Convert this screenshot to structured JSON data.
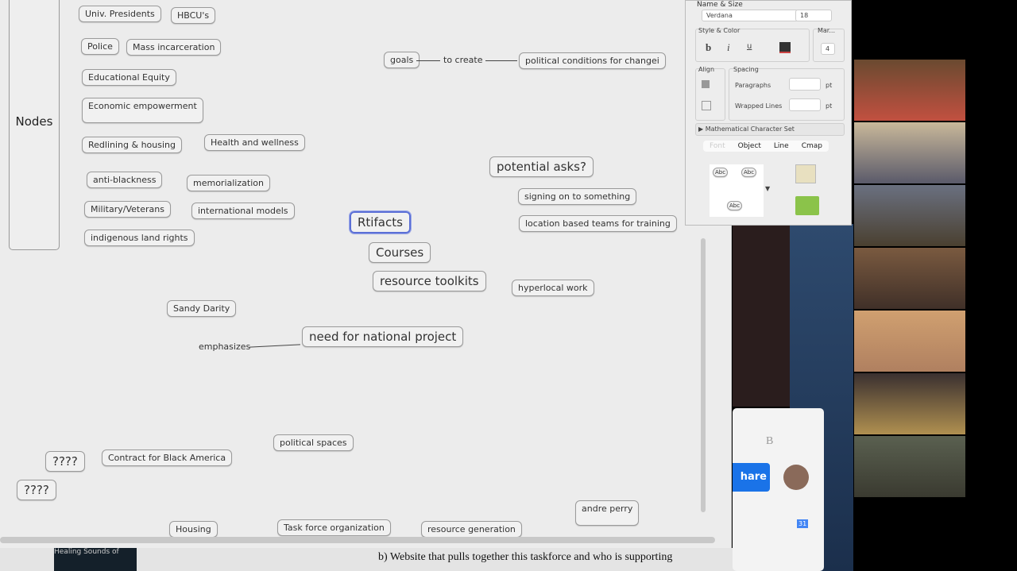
{
  "sidebar": {
    "title": "Nodes"
  },
  "nodes": [
    "Univ. Presidents",
    "HBCU's",
    "Police",
    "Mass incarceration",
    "Educational Equity",
    "Economic empowerment",
    "Redlining & housing",
    "Health and wellness",
    "anti-blackness",
    "memorialization",
    "Military/Veterans",
    "international models",
    "indigenous land rights",
    "goals",
    "political conditions for changei",
    "potential asks?",
    "signing on to something",
    "location based teams for training",
    "Rtifacts",
    "Courses",
    "resource toolkits",
    "hyperlocal work",
    "Sandy Darity",
    "need for national project",
    "political spaces",
    "????",
    "Contract for Black America",
    "????",
    "Housing",
    "Task force organization",
    "resource generation",
    "andre perry"
  ],
  "links": {
    "to_create": "to create",
    "emphasizes": "emphasizes"
  },
  "format_panel": {
    "name_size": "Name & Size",
    "font": "Verdana",
    "size": "18",
    "style_color": "Style & Color",
    "bold": "b",
    "italic": "i",
    "underline": "u",
    "margin_label": "Mar...",
    "margin": "4",
    "align": "Align",
    "spacing": "Spacing",
    "paragraphs": "Paragraphs",
    "wrapped_lines": "Wrapped Lines",
    "pt": "pt",
    "math_set": "Mathematical Character Set",
    "tabs": [
      "Font",
      "Object",
      "Line",
      "Cmap"
    ],
    "abc": "Abc"
  },
  "browser": {
    "share": "hare",
    "bold": "B",
    "calendar": "31"
  },
  "bottom": {
    "video_title": "Healing Sounds of",
    "doc_text": "b)  Website that pulls together this taskforce and who is supporting"
  },
  "colors": {
    "accent": "#1a73e8",
    "selection": "#5b6fd6"
  }
}
